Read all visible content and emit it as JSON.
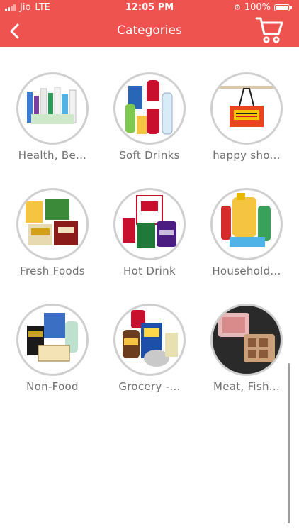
{
  "status_bar": {
    "carrier": "Jio",
    "network": "LTE",
    "time": "12:05 PM",
    "battery": "100%"
  },
  "header": {
    "title": "Categories",
    "back_icon": "chevron-left-icon",
    "cart_icon": "shopping-cart-icon",
    "background": "#ef5350"
  },
  "categories": [
    {
      "label": "Health, Be...",
      "image": "health-beauty-products"
    },
    {
      "label": "Soft Drinks",
      "image": "soft-drink-bottles"
    },
    {
      "label": "happy sho...",
      "image": "happy-shopper-tote-bag"
    },
    {
      "label": "Fresh Foods",
      "image": "fresh-food-packs"
    },
    {
      "label": "Hot Drink",
      "image": "tea-coffee-packs"
    },
    {
      "label": "Household...",
      "image": "cleaning-products"
    },
    {
      "label": "Non-Food",
      "image": "batteries-and-household-items"
    },
    {
      "label": "Grocery -...",
      "image": "grocery-jars-and-tins"
    },
    {
      "label": "Meat, Fish...",
      "image": "meat-trays"
    }
  ]
}
